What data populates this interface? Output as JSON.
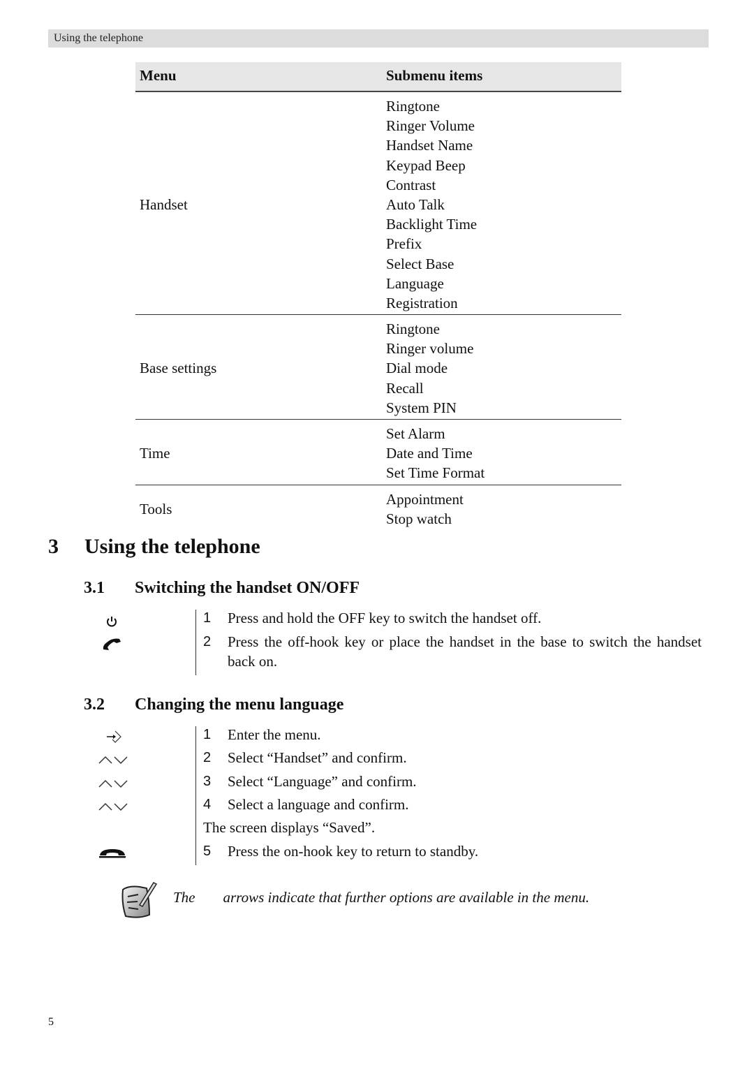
{
  "header": {
    "running_title": "Using the telephone"
  },
  "menu_table": {
    "columns": [
      "Menu",
      "Submenu items"
    ],
    "rows": [
      {
        "menu": "Handset",
        "items": [
          "Ringtone",
          "Ringer Volume",
          "Handset Name",
          "Keypad Beep",
          "Contrast",
          "Auto Talk",
          "Backlight Time",
          "Prefix",
          "Select Base",
          "Language",
          "Registration"
        ]
      },
      {
        "menu": "Base settings",
        "items": [
          "Ringtone",
          "Ringer volume",
          "Dial mode",
          "Recall",
          "System PIN"
        ]
      },
      {
        "menu": "Time",
        "items": [
          "Set Alarm",
          "Date and Time",
          "Set Time Format"
        ]
      },
      {
        "menu": "Tools",
        "items": [
          "Appointment",
          "Stop watch"
        ]
      }
    ]
  },
  "section3": {
    "number": "3",
    "title": "Using the telephone"
  },
  "section31": {
    "number": "3.1",
    "title": "Switching the handset ON/OFF",
    "steps": [
      {
        "n": "1",
        "icon": "power-icon",
        "text": "Press and hold the OFF key to switch the handset off."
      },
      {
        "n": "2",
        "icon": "off-hook-icon",
        "text": "Press the off-hook key or place the handset in the base to switch the handset back on."
      }
    ]
  },
  "section32": {
    "number": "3.2",
    "title": "Changing the menu language",
    "steps": [
      {
        "n": "1",
        "icon": "menu-enter-icon",
        "text": "Enter the menu."
      },
      {
        "n": "2",
        "icon": "up-down-arrows-icon",
        "text": "Select “Handset” and confirm."
      },
      {
        "n": "3",
        "icon": "up-down-arrows-icon",
        "text": "Select “Language” and confirm."
      },
      {
        "n": "4",
        "icon": "up-down-arrows-icon",
        "text": "Select a language and confirm."
      }
    ],
    "info": "The screen displays “Saved”.",
    "final_step": {
      "n": "5",
      "icon": "on-hook-icon",
      "text": "Press the on-hook key to return to standby."
    }
  },
  "note": {
    "icon": "note-icon",
    "text_before": "The",
    "text_after": "arrows indicate that further options are available in the menu."
  },
  "footer": {
    "page_number": "5"
  }
}
